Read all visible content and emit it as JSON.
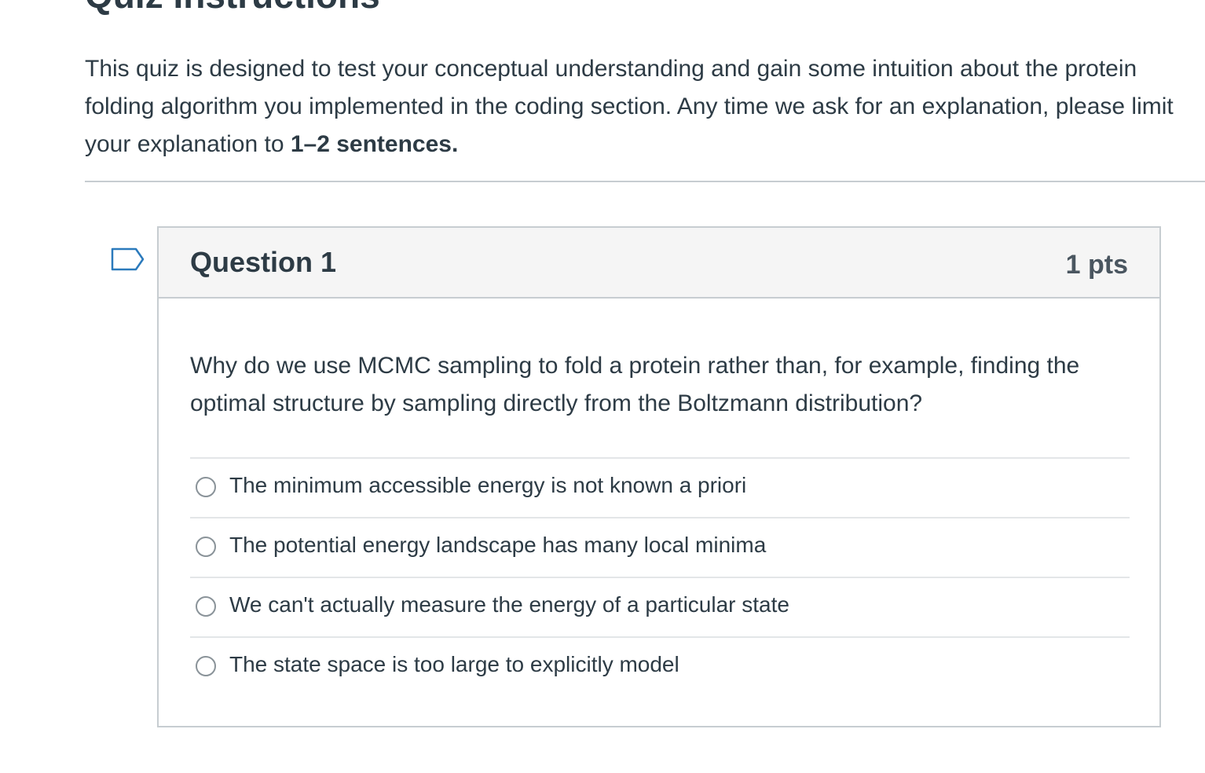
{
  "quiz": {
    "heading": "Quiz Instructions",
    "intro_lines": [
      "This quiz is designed to test your conceptual understanding and gain some intuition about the protein",
      "folding algorithm you implemented in the coding section. Any time we ask for an explanation, please limit"
    ],
    "intro_last_prefix": "your explanation to ",
    "intro_last_bold": "1–2 sentences."
  },
  "question": {
    "flag_icon": "bookmark-flag-icon",
    "title": "Question 1",
    "points": "1 pts",
    "text": "Why do we use MCMC sampling to fold a protein rather than, for example, finding the optimal structure by sampling directly from the Boltzmann distribution?",
    "answers": [
      {
        "label": "The minimum accessible energy is not known a priori"
      },
      {
        "label": "The potential energy landscape has many local minima"
      },
      {
        "label": "We can't actually measure the energy of a particular state"
      },
      {
        "label": "The state space is too large to explicitly model"
      }
    ]
  }
}
